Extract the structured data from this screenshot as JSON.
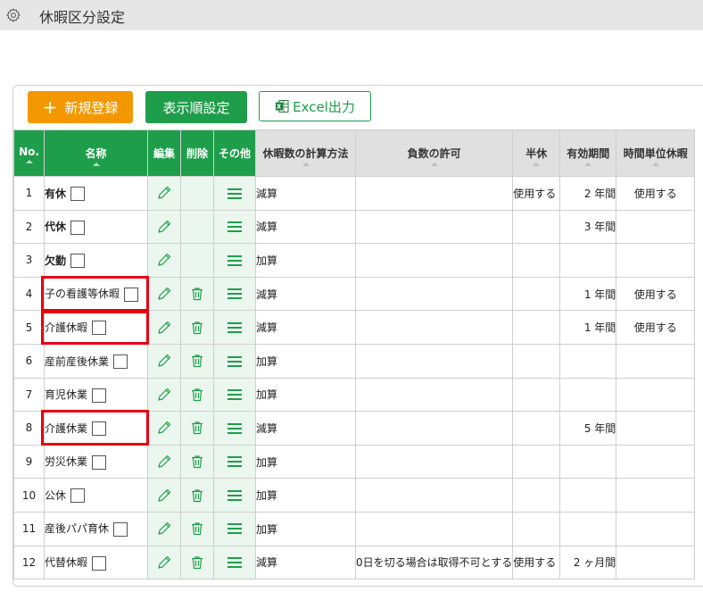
{
  "page": {
    "title": "休暇区分設定",
    "accent_green": "#1e9e4a",
    "accent_orange": "#f39800",
    "highlight_red": "#e60012"
  },
  "toolbar": {
    "new_label": "新規登録",
    "order_label": "表示順設定",
    "excel_label": "Excel出力"
  },
  "columns": {
    "no": "No.",
    "name": "名称",
    "edit": "編集",
    "delete": "削除",
    "other": "その他",
    "calc": "休暇数の計算方法",
    "negative": "負数の許可",
    "half": "半休",
    "valid": "有効期間",
    "hourly": "時間単位休暇"
  },
  "rows": [
    {
      "no": "1",
      "name": "有休",
      "bold": true,
      "deletable": false,
      "calc": "減算",
      "negative": "",
      "half": "使用する",
      "valid": "2 年間",
      "hourly": "使用する"
    },
    {
      "no": "2",
      "name": "代休",
      "bold": true,
      "deletable": false,
      "calc": "減算",
      "negative": "",
      "half": "",
      "valid": "3 年間",
      "hourly": ""
    },
    {
      "no": "3",
      "name": "欠勤",
      "bold": true,
      "deletable": false,
      "calc": "加算",
      "negative": "",
      "half": "",
      "valid": "",
      "hourly": ""
    },
    {
      "no": "4",
      "name": "子の看護等休暇",
      "bold": false,
      "deletable": true,
      "calc": "減算",
      "negative": "",
      "half": "",
      "valid": "1 年間",
      "hourly": "使用する"
    },
    {
      "no": "5",
      "name": "介護休暇",
      "bold": false,
      "deletable": true,
      "calc": "減算",
      "negative": "",
      "half": "",
      "valid": "1 年間",
      "hourly": "使用する"
    },
    {
      "no": "6",
      "name": "産前産後休業",
      "bold": false,
      "deletable": true,
      "calc": "加算",
      "negative": "",
      "half": "",
      "valid": "",
      "hourly": ""
    },
    {
      "no": "7",
      "name": "育児休業",
      "bold": false,
      "deletable": true,
      "calc": "加算",
      "negative": "",
      "half": "",
      "valid": "",
      "hourly": ""
    },
    {
      "no": "8",
      "name": "介護休業",
      "bold": false,
      "deletable": true,
      "calc": "減算",
      "negative": "",
      "half": "",
      "valid": "5 年間",
      "hourly": ""
    },
    {
      "no": "9",
      "name": "労災休業",
      "bold": false,
      "deletable": true,
      "calc": "加算",
      "negative": "",
      "half": "",
      "valid": "",
      "hourly": ""
    },
    {
      "no": "10",
      "name": "公休",
      "bold": false,
      "deletable": true,
      "calc": "加算",
      "negative": "",
      "half": "",
      "valid": "",
      "hourly": ""
    },
    {
      "no": "11",
      "name": "産後パパ育休",
      "bold": false,
      "deletable": true,
      "calc": "加算",
      "negative": "",
      "half": "",
      "valid": "",
      "hourly": ""
    },
    {
      "no": "12",
      "name": "代替休暇",
      "bold": false,
      "deletable": true,
      "calc": "減算",
      "negative": "0日を切る場合は取得不可とする",
      "half": "使用する",
      "valid": "2 ヶ月間",
      "hourly": ""
    }
  ],
  "icons": {
    "settings": "gear-icon",
    "edit": "pencil-icon",
    "delete": "trash-icon",
    "other": "menu-icon",
    "excel": "excel-icon",
    "new": "plus-icon"
  }
}
